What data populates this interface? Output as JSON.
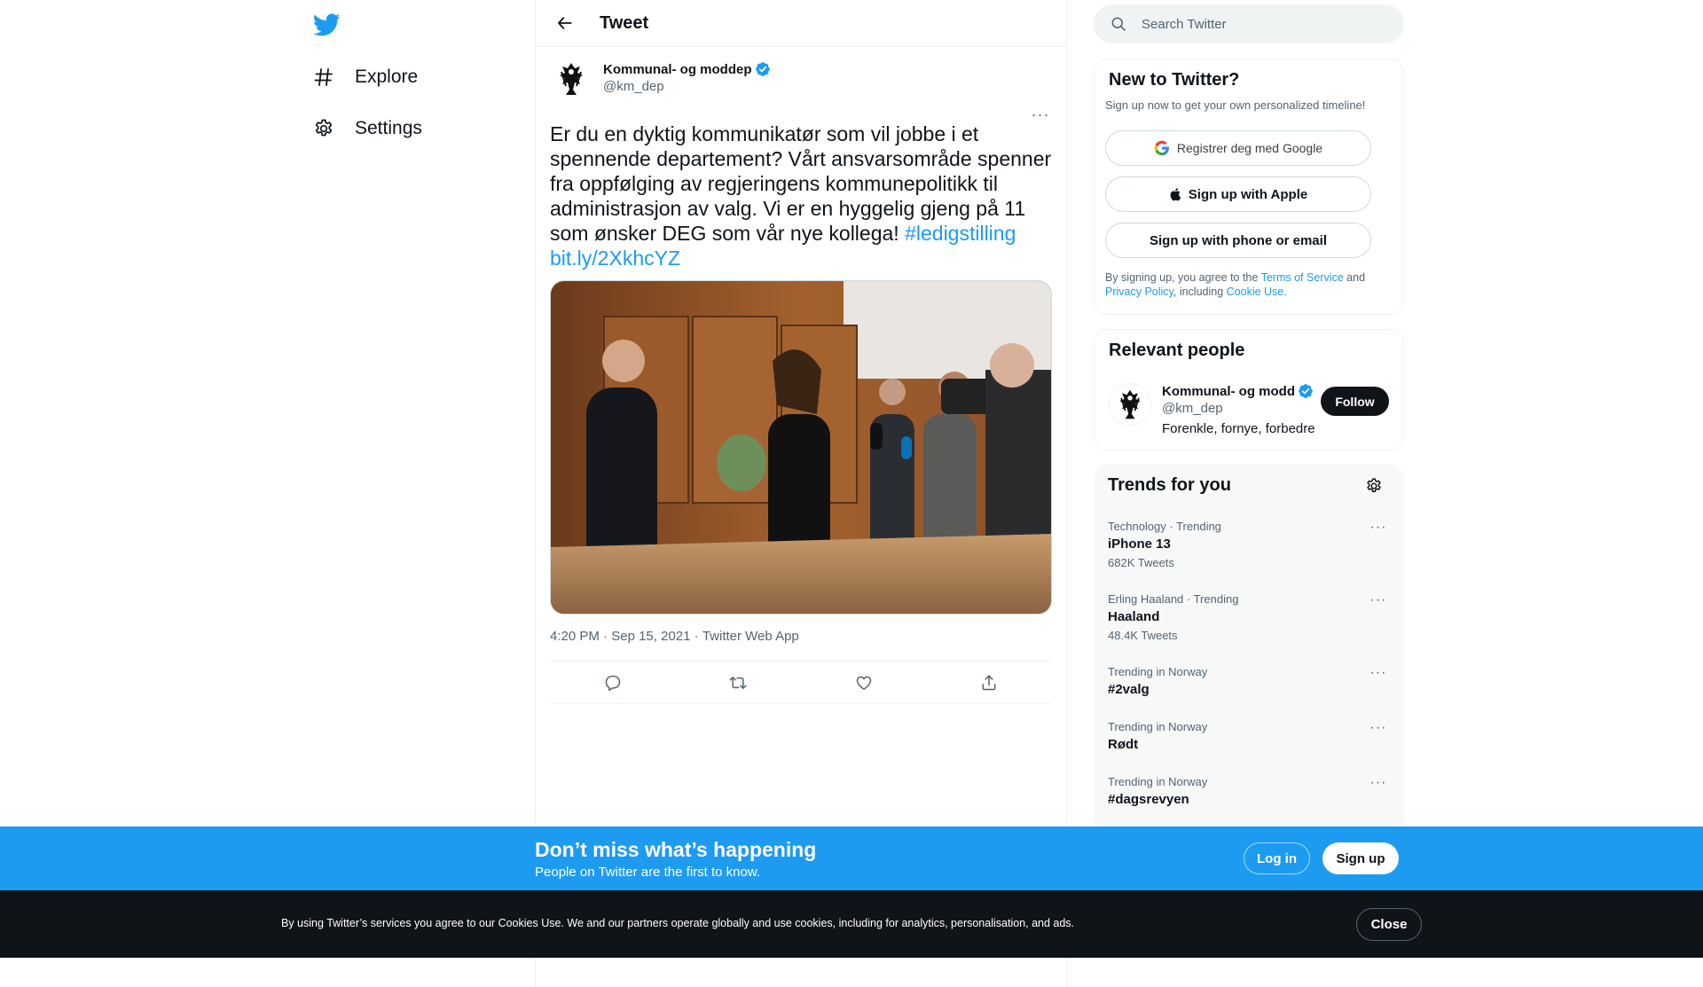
{
  "colors": {
    "accent": "#1d9bf0",
    "text": "#0f1419",
    "muted": "#536471",
    "banner": "#1d9bf0",
    "cookie_bar": "#0f1419"
  },
  "nav": {
    "logo_icon": "twitter-bird-icon",
    "items": [
      {
        "label": "Explore",
        "icon": "hashtag-icon"
      },
      {
        "label": "Settings",
        "icon": "gear-icon"
      }
    ]
  },
  "header": {
    "title": "Tweet",
    "back_icon": "arrow-left-icon"
  },
  "tweet": {
    "author_name": "Kommunal- og moddep",
    "handle": "@km_dep",
    "verified": true,
    "text": "Er du en dyktig kommunikatør som vil jobbe i et spennende departement? Vårt ansvarsområde spenner fra oppfølging av regjeringens kommunepolitikk til administrasjon av valg. Vi er en hyggelig gjeng på 11 som ønsker DEG som vår nye kollega! ",
    "hashtag": "#ledigstilling",
    "link": "bit.ly/2XkhcYZ",
    "time": "4:20 PM",
    "date": "Sep 15, 2021",
    "source": "Twitter Web App",
    "separator": " · ",
    "actions": [
      "reply-icon",
      "retweet-icon",
      "like-icon",
      "share-icon"
    ]
  },
  "search": {
    "placeholder": "Search Twitter"
  },
  "new_to_twitter": {
    "title": "New to Twitter?",
    "subtitle": "Sign up now to get your own personalized timeline!",
    "google_label": "Registrer deg med Google",
    "apple_label": "Sign up with Apple",
    "phone_label": "Sign up with phone or email",
    "legal_prefix": "By signing up, you agree to the ",
    "terms": "Terms of Service",
    "and": " and ",
    "privacy": "Privacy Policy",
    "including": ", including ",
    "cookie_use": "Cookie Use."
  },
  "relevant_people": {
    "title": "Relevant people",
    "name": "Kommunal- og modd",
    "handle": "@km_dep",
    "bio": "Forenkle, fornye, forbedre",
    "follow_label": "Follow"
  },
  "trends": {
    "title": "Trends for you",
    "items": [
      {
        "context": "Technology · Trending",
        "name": "iPhone 13",
        "count": "682K Tweets"
      },
      {
        "context": "Erling Haaland · Trending",
        "name": "Haaland",
        "count": "48.4K Tweets"
      },
      {
        "context": "Trending in Norway",
        "name": "#2valg",
        "count": ""
      },
      {
        "context": "Trending in Norway",
        "name": "Rødt",
        "count": ""
      },
      {
        "context": "Trending in Norway",
        "name": "#dagsrevyen",
        "count": ""
      }
    ],
    "more_glyph": "···"
  },
  "banner": {
    "title": "Don’t miss what’s happening",
    "subtitle": "People on Twitter are the first to know.",
    "login_label": "Log in",
    "signup_label": "Sign up"
  },
  "cookie_bar": {
    "text_prefix": "By using Twitter’s services you agree to our ",
    "cookies_use": "Cookies Use",
    "text_suffix": ". We and our partners operate globally and use cookies, including for analytics, personalisation, and ads.",
    "close_label": "Close"
  }
}
